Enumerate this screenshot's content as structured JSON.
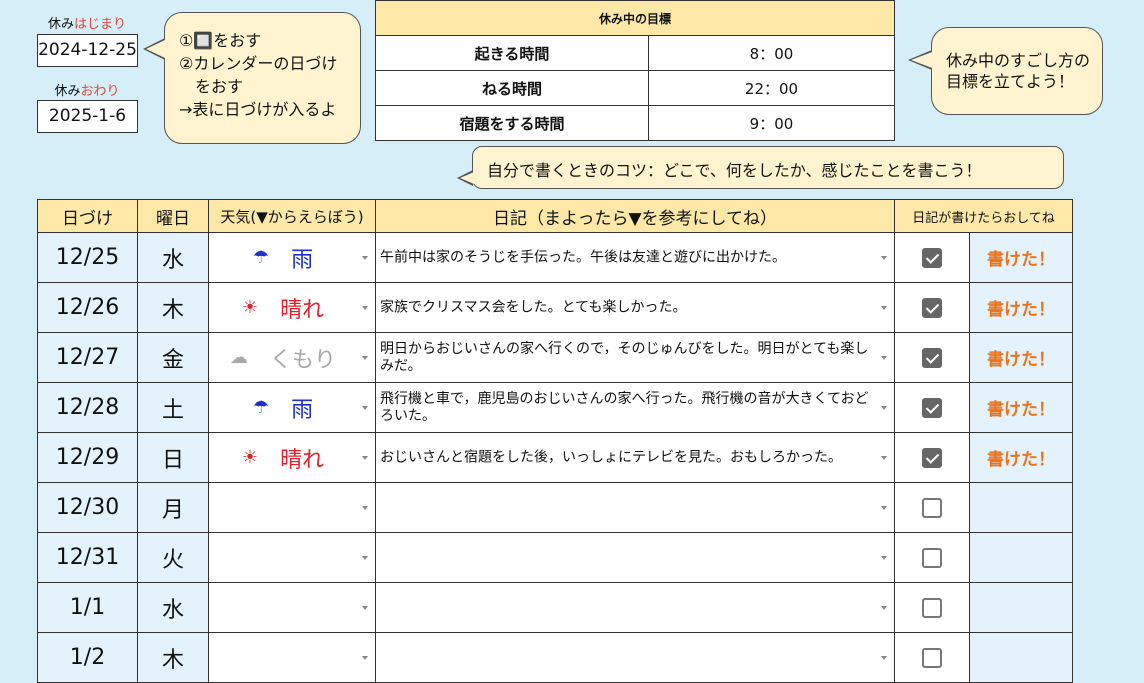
{
  "start": {
    "label_prefix": "休み",
    "label_accent": "はじまり",
    "date": "2024-12-25"
  },
  "end": {
    "label_prefix": "休み",
    "label_accent": "おわり",
    "date": "2025-1-6"
  },
  "hint_bubble": {
    "line1": "①🔲をおす",
    "line2": "②カレンダーの日づけ",
    "line3": "　をおす",
    "line4": "→表に日づけが入るよ"
  },
  "goals": {
    "header": "休み中の目標",
    "rows": [
      {
        "label": "起きる時間",
        "value": "8：00"
      },
      {
        "label": "ねる時間",
        "value": "22：00"
      },
      {
        "label": "宿題をする時間",
        "value": "9：00"
      }
    ]
  },
  "goal_bubble": {
    "line1": "休み中のすごし方の",
    "line2": "目標を立てよう！"
  },
  "tip_bubble": "自分で書くときのコツ：どこで、何をしたか、感じたことを書こう！",
  "table": {
    "headers": {
      "date": "日づけ",
      "weekday": "曜日",
      "weather": "天気(▼からえらぼう)",
      "diary": "日記（まよったら▼を参考にしてね）",
      "check": "日記が書けたらおしてね"
    },
    "rows": [
      {
        "date": "12/25",
        "weekday": "水",
        "weather_icon": "umbrella-icon",
        "weather_glyph": "☂",
        "weather": "雨",
        "diary": "午前中は家のそうじを手伝った。午後は友達と遊びに出かけた。",
        "checked": true,
        "done": "書けた！"
      },
      {
        "date": "12/26",
        "weekday": "木",
        "weather_icon": "sun-icon",
        "weather_glyph": "☀",
        "weather": "晴れ",
        "diary": "家族でクリスマス会をした。とても楽しかった。",
        "checked": true,
        "done": "書けた！"
      },
      {
        "date": "12/27",
        "weekday": "金",
        "weather_icon": "cloud-icon",
        "weather_glyph": "☁",
        "weather": "くもり",
        "diary": "明日からおじいさんの家へ行くので，そのじゅんびをした。明日がとても楽しみだ。",
        "checked": true,
        "done": "書けた！"
      },
      {
        "date": "12/28",
        "weekday": "土",
        "weather_icon": "umbrella-icon",
        "weather_glyph": "☂",
        "weather": "雨",
        "diary": "飛行機と車で，鹿児島のおじいさんの家へ行った。飛行機の音が大きくておどろいた。",
        "checked": true,
        "done": "書けた！"
      },
      {
        "date": "12/29",
        "weekday": "日",
        "weather_icon": "sun-icon",
        "weather_glyph": "☀",
        "weather": "晴れ",
        "diary": "おじいさんと宿題をした後，いっしょにテレビを見た。おもしろかった。",
        "checked": true,
        "done": "書けた！"
      },
      {
        "date": "12/30",
        "weekday": "月",
        "weather_icon": "",
        "weather_glyph": "",
        "weather": "",
        "diary": "",
        "checked": false,
        "done": ""
      },
      {
        "date": "12/31",
        "weekday": "火",
        "weather_icon": "",
        "weather_glyph": "",
        "weather": "",
        "diary": "",
        "checked": false,
        "done": ""
      },
      {
        "date": "1/1",
        "weekday": "水",
        "weather_icon": "",
        "weather_glyph": "",
        "weather": "",
        "diary": "",
        "checked": false,
        "done": ""
      },
      {
        "date": "1/2",
        "weekday": "木",
        "weather_icon": "",
        "weather_glyph": "",
        "weather": "",
        "diary": "",
        "checked": false,
        "done": ""
      }
    ]
  },
  "colors": {
    "rain": "#1f2fcf",
    "sun": "#e0202a",
    "cloud": "#a8a8a8",
    "done": "#e8741e"
  }
}
